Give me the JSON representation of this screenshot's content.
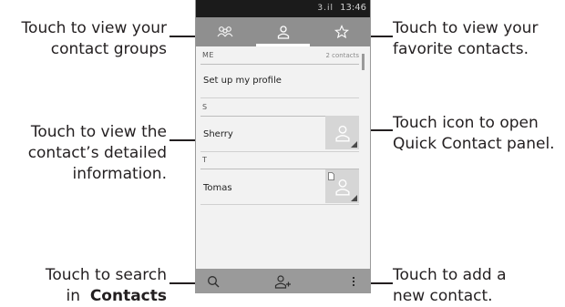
{
  "callouts": {
    "groups": [
      "Touch to view your",
      "contact groups"
    ],
    "favorites": [
      "Touch to view your",
      "favorite contacts."
    ],
    "details": [
      "Touch to view the",
      "contact’s detailed",
      "information."
    ],
    "quick_contact": [
      "Touch icon to open",
      "Quick Contact panel."
    ],
    "search": {
      "line1": "Touch to search",
      "line2_prefix": "in",
      "line2_bold": "Contacts"
    },
    "add": [
      "Touch to add a",
      "new contact."
    ]
  },
  "status_bar": {
    "time": "13:46",
    "icons": "3.il"
  },
  "tabs": [
    {
      "icon": "contact-groups-icon",
      "selected": false
    },
    {
      "icon": "person-icon",
      "selected": true
    },
    {
      "icon": "star-icon",
      "selected": false
    }
  ],
  "contacts": {
    "me_header": "ME",
    "me_count": "2 contacts",
    "profile_label": "Set up my profile",
    "sections": [
      {
        "letter": "S",
        "name": "Sherry"
      },
      {
        "letter": "T",
        "name": "Tomas"
      }
    ]
  },
  "bottom_bar": {
    "icons": [
      "search-icon",
      "add-contact-icon",
      "overflow-menu-icon"
    ]
  },
  "colors": {
    "tab_bar": "#8f8f8f",
    "status_bar": "#1b1b1b",
    "list_bg": "#f2f2f2",
    "bottom_bar": "#9a9a9a"
  }
}
